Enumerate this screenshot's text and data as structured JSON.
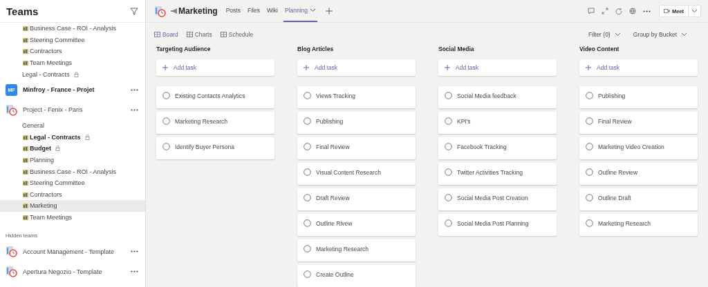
{
  "sidebar": {
    "title": "Teams",
    "items": [
      {
        "kind": "channel",
        "label": "Business Case - ROI - Analysis",
        "icon": true,
        "bold": false,
        "locked": false,
        "selected": false
      },
      {
        "kind": "channel",
        "label": "Steering Committee",
        "icon": true,
        "bold": false,
        "locked": false,
        "selected": false
      },
      {
        "kind": "channel",
        "label": "Contractors",
        "icon": true,
        "bold": false,
        "locked": false,
        "selected": false
      },
      {
        "kind": "channel",
        "label": "Team Meetings",
        "icon": true,
        "bold": false,
        "locked": false,
        "selected": false
      },
      {
        "kind": "channel",
        "label": "Legal - Contracts",
        "icon": false,
        "bold": false,
        "locked": true,
        "selected": false
      },
      {
        "kind": "team",
        "label": "Minfroy - France - Projet",
        "avatar": "MF",
        "bold": true
      },
      {
        "kind": "team",
        "label": "Project - Fenix - Paris",
        "bold": false
      },
      {
        "kind": "channel",
        "label": "General",
        "icon": false,
        "bold": false,
        "locked": false,
        "selected": false
      },
      {
        "kind": "channel",
        "label": "Legal - Contracts",
        "icon": true,
        "bold": true,
        "locked": true,
        "selected": false
      },
      {
        "kind": "channel",
        "label": "Budget",
        "icon": true,
        "bold": true,
        "locked": true,
        "selected": false
      },
      {
        "kind": "channel",
        "label": "Planning",
        "icon": true,
        "bold": false,
        "locked": false,
        "selected": false
      },
      {
        "kind": "channel",
        "label": "Business Case - ROI - Analysis",
        "icon": true,
        "bold": false,
        "locked": false,
        "selected": false
      },
      {
        "kind": "channel",
        "label": "Steering Committee",
        "icon": true,
        "bold": false,
        "locked": false,
        "selected": false
      },
      {
        "kind": "channel",
        "label": "Contractors",
        "icon": true,
        "bold": false,
        "locked": false,
        "selected": false
      },
      {
        "kind": "channel",
        "label": "Marketing",
        "icon": true,
        "bold": false,
        "locked": false,
        "selected": true
      },
      {
        "kind": "channel",
        "label": "Team Meetings",
        "icon": true,
        "bold": false,
        "locked": false,
        "selected": false
      },
      {
        "kind": "heading",
        "label": "Hidden teams"
      },
      {
        "kind": "team",
        "label": "Account Management - Template",
        "bold": false
      },
      {
        "kind": "team",
        "label": "Apertura Negozio - Template",
        "bold": false
      }
    ]
  },
  "header": {
    "title": "Marketing",
    "tabs": [
      {
        "label": "Posts",
        "selected": false,
        "dropdown": false
      },
      {
        "label": "Files",
        "selected": false,
        "dropdown": false
      },
      {
        "label": "Wiki",
        "selected": false,
        "dropdown": false
      },
      {
        "label": "Planning",
        "selected": true,
        "dropdown": true
      }
    ],
    "meet": "Meet"
  },
  "views": [
    {
      "label": "Board",
      "selected": true
    },
    {
      "label": "Charts",
      "selected": false
    },
    {
      "label": "Schedule",
      "selected": false
    }
  ],
  "filter": "Filter (0)",
  "group_by": "Group by Bucket",
  "buckets": [
    {
      "name": "Targeting Audience",
      "add": "Add task",
      "tasks": [
        "Existing Contacts Analytics",
        "Marketing Research",
        "Identify Buyer Persona"
      ]
    },
    {
      "name": "Blog Articles",
      "add": "Add task",
      "tasks": [
        "Views Tracking",
        "Publishing",
        "Final Review",
        "Visual Content Research",
        "Draft Review",
        "Outline Rivew",
        "Marketing Research",
        "Create Outline"
      ]
    },
    {
      "name": "Social Media",
      "add": "Add task",
      "tasks": [
        "Social Media feedback",
        "KPI's",
        "Facebook Tracking",
        "Twitter Activities Tracking",
        "Social Media Post Creation",
        "Social Media Post Planning"
      ]
    },
    {
      "name": "Video Content",
      "add": "Add task",
      "tasks": [
        "Publishing",
        "Final Review",
        "Marketing Video Creation",
        "Outline Review",
        "Outline Draft",
        "Marketing Research"
      ]
    }
  ]
}
